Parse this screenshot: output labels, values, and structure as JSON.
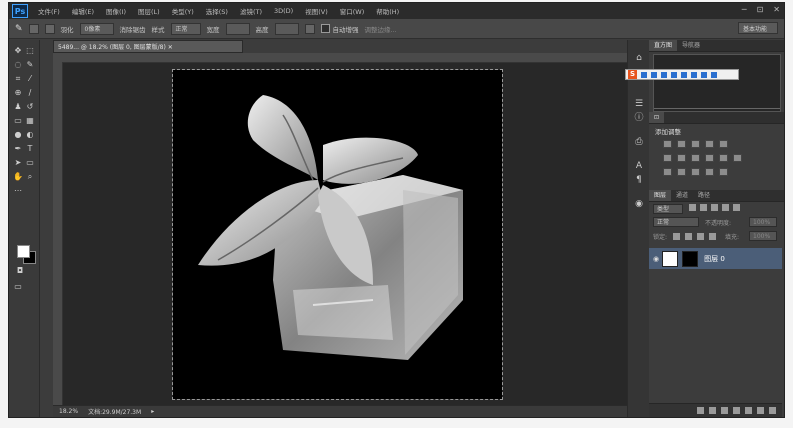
{
  "app": {
    "logo": "Ps"
  },
  "menu": [
    "文件(F)",
    "编辑(E)",
    "图像(I)",
    "图层(L)",
    "类型(Y)",
    "选择(S)",
    "滤镜(T)",
    "3D(D)",
    "视图(V)",
    "窗口(W)",
    "帮助(H)"
  ],
  "window_controls": [
    "─",
    "⊡",
    "✕"
  ],
  "options": {
    "feather_label": "羽化",
    "feather_value": "0像素",
    "antialias_label": "消除锯齿",
    "style_label": "样式",
    "style_value": "正常",
    "width_label": "宽度",
    "height_label": "高度",
    "auto_enhance_label": "自动增强",
    "refine_edge_label": "调整边缘...",
    "workspace": "基本功能"
  },
  "document": {
    "tab_title": "5489... @ 18.2% (图层 0, 图层蒙版/8) ✕",
    "zoom": "18.2%",
    "doc_size": "文档:29.9M/27.3M"
  },
  "panels": {
    "top_tabs": [
      "直方图",
      "导航器"
    ],
    "adjustments_title": "添加调整",
    "layers_tabs": [
      "图层",
      "通道",
      "路径"
    ],
    "kind_label": "类型",
    "blend_mode": "正常",
    "opacity_label": "不透明度:",
    "opacity_value": "100%",
    "lock_label": "锁定:",
    "fill_label": "填充:",
    "fill_value": "100%",
    "layer_name": "图层 0"
  },
  "ime": {
    "logo": "S"
  }
}
